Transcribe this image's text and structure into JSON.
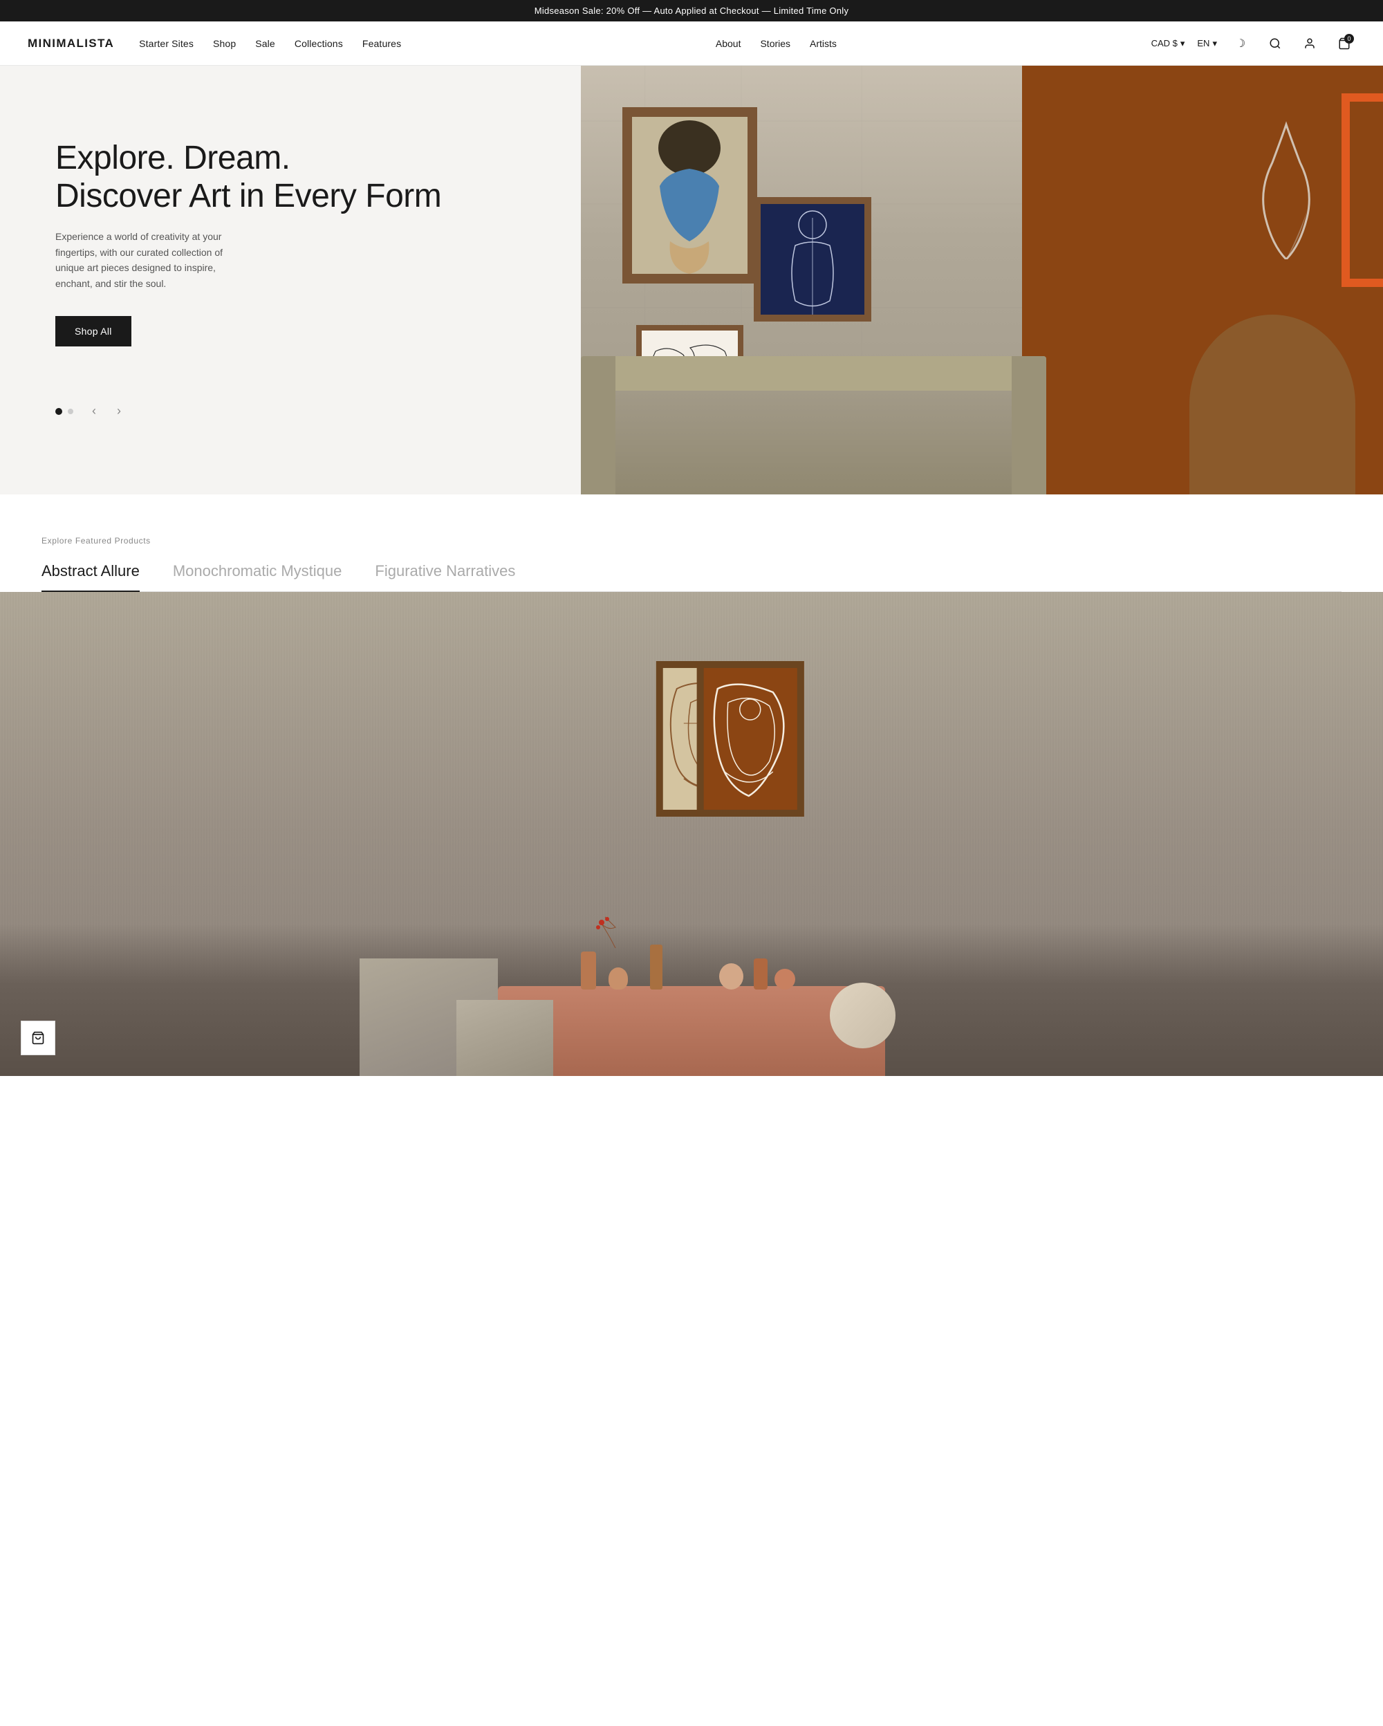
{
  "announcement": {
    "text": "Midseason Sale: 20% Off — Auto Applied at Checkout — Limited Time Only"
  },
  "header": {
    "logo": "MINIMALISTA",
    "nav_main": [
      {
        "label": "Starter Sites",
        "id": "starter-sites"
      },
      {
        "label": "Shop",
        "id": "shop"
      },
      {
        "label": "Sale",
        "id": "sale"
      },
      {
        "label": "Collections",
        "id": "collections"
      },
      {
        "label": "Features",
        "id": "features"
      }
    ],
    "nav_secondary": [
      {
        "label": "About",
        "id": "about"
      },
      {
        "label": "Stories",
        "id": "stories"
      },
      {
        "label": "Artists",
        "id": "artists"
      }
    ],
    "currency": "CAD $",
    "language": "EN",
    "cart_count": "0"
  },
  "hero": {
    "title_line1": "Explore. Dream.",
    "title_line2": "Discover Art in Every Form",
    "description": "Experience a world of creativity at your fingertips, with our curated collection of unique art pieces designed to inspire, enchant, and stir the soul.",
    "cta_label": "Shop All",
    "carousel_slide": 1,
    "carousel_total": 2
  },
  "featured": {
    "section_label": "Explore Featured Products",
    "tabs": [
      {
        "label": "Abstract Allure",
        "id": "abstract-allure",
        "active": true
      },
      {
        "label": "Monochromatic Mystique",
        "id": "monochromatic-mystique",
        "active": false
      },
      {
        "label": "Figurative Narratives",
        "id": "figurative-narratives",
        "active": false
      }
    ]
  },
  "icons": {
    "moon": "☽",
    "search": "🔍",
    "user": "👤",
    "cart": "🛒",
    "chevron_down": "▾",
    "arrow_left": "‹",
    "arrow_right": "›",
    "cart_float": "🛍"
  }
}
